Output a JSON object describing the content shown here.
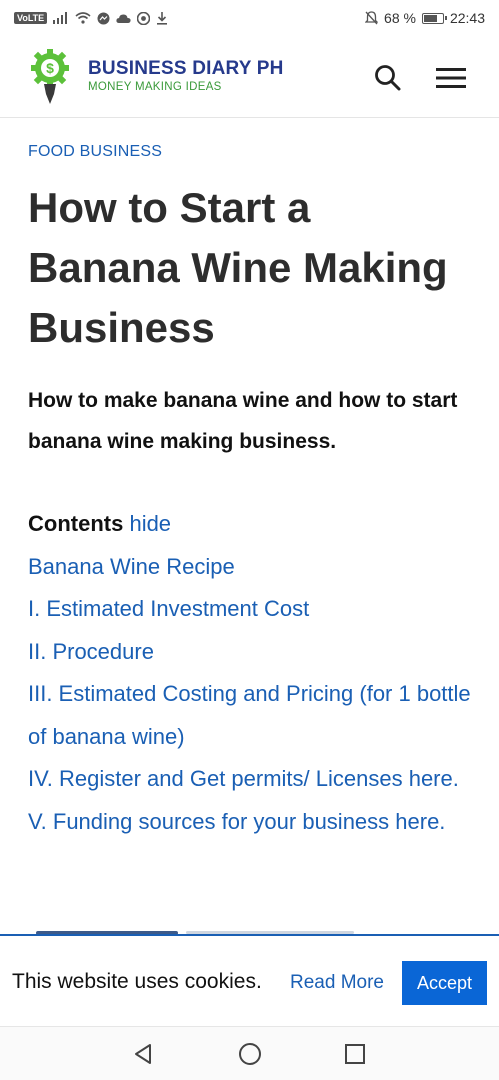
{
  "status_bar": {
    "volte": "VoLTE",
    "battery_text": "68 %",
    "time": "22:43",
    "icons": [
      "signal-icon",
      "wifi-icon",
      "messenger-icon",
      "cloud-icon",
      "chrome-icon",
      "download-icon",
      "mute-icon",
      "battery-icon"
    ]
  },
  "header": {
    "brand_name": "BUSINESS DIARY PH",
    "tagline": "MONEY MAKING IDEAS",
    "logo_symbol": "$",
    "colors": {
      "brand": "#263a8c",
      "tagline": "#3a9a3a",
      "logo_green": "#5cc13a"
    },
    "icons": [
      "search-icon",
      "menu-icon"
    ]
  },
  "article": {
    "category": "FOOD BUSINESS",
    "title": "How to Start a Banana Wine Making Business",
    "subtitle": "How to make banana wine and how to start banana wine making business."
  },
  "toc": {
    "title": "Contents",
    "toggle": "hide",
    "items": [
      "Banana Wine Recipe",
      "I. Estimated Investment Cost",
      "II. Procedure",
      "III. Estimated Costing and Pricing (for 1 bottle of banana wine)",
      "IV. Register and Get permits/ Licenses here.",
      "V. Funding sources for your business here."
    ],
    "link_color": "#1a5fb4"
  },
  "cookie": {
    "text": "This website uses cookies.",
    "read_more": "Read More",
    "accept": "Accept",
    "accept_color": "#0a66d6"
  },
  "nav": {
    "icons": [
      "back-icon",
      "home-icon",
      "recents-icon"
    ]
  }
}
